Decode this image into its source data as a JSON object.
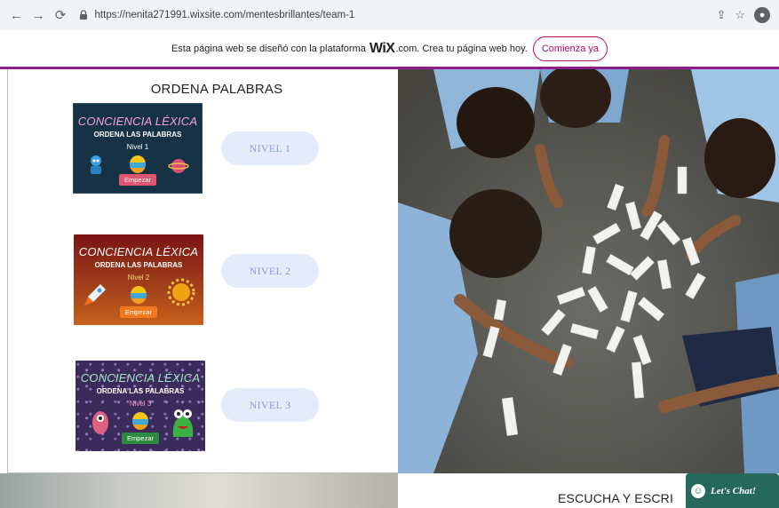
{
  "browser": {
    "url": "https://nenita271991.wixsite.com/mentesbrillantes/team-1",
    "back_icon": "arrow-left-icon",
    "forward_icon": "arrow-right-icon",
    "reload_icon": "reload-icon",
    "share_icon": "share-icon",
    "bookmark_icon": "star-icon",
    "profile_icon": "profile-icon"
  },
  "wix_banner": {
    "text_before": "Esta página web se diseñó con la plataforma",
    "logo": "WiX",
    "text_after": ".com. Crea tu página web hoy.",
    "cta_label": "Comienza ya"
  },
  "section": {
    "title": "ORDENA PALABRAS"
  },
  "cards": [
    {
      "title": "CONCIENCIA LÉXICA",
      "subtitle": "ORDENA LAS PALABRAS",
      "level": "Nivel 1",
      "button": "Empezar"
    },
    {
      "title": "CONCIENCIA LÉXICA",
      "subtitle": "ORDENA LAS PALABRAS",
      "level": "Nivel 2",
      "button": "Empezar"
    },
    {
      "title": "CONCIENCIA LÉXICA",
      "subtitle": "ORDENA LAS PALABRAS",
      "level": "Nivel 3",
      "button": "Empezar"
    }
  ],
  "levels": [
    {
      "label": "NIVEL 1"
    },
    {
      "label": "NIVEL 2"
    },
    {
      "label": "NIVEL 3"
    }
  ],
  "next_section": {
    "title": "ESCUCHA Y ESCRI"
  },
  "chat": {
    "label": "Let's Chat!"
  },
  "colors": {
    "accent": "#8a1e8f",
    "cta": "#b00e6b",
    "level_button_bg": "#e5ebfb",
    "chat_bg": "#26695b"
  }
}
